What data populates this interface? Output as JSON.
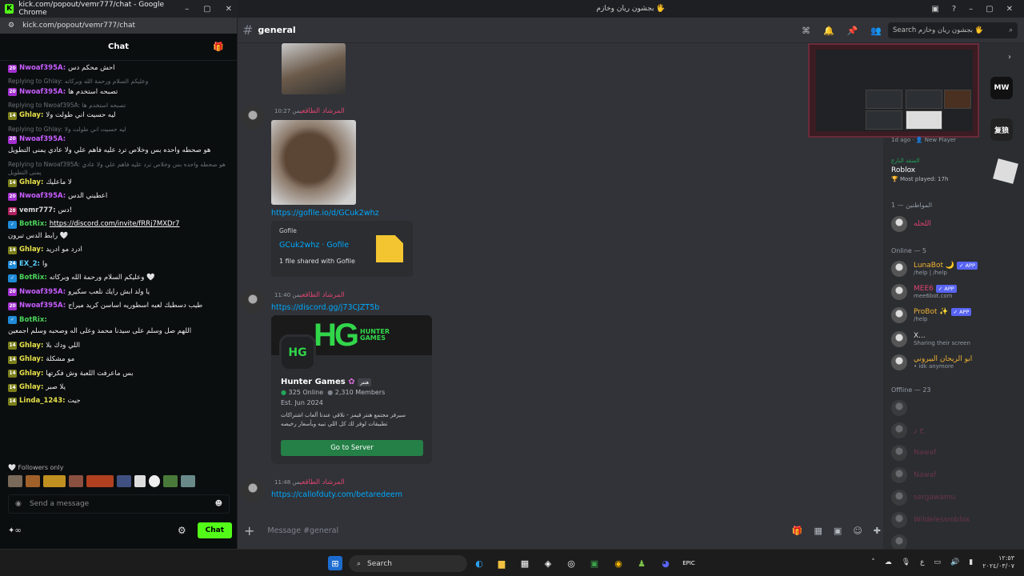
{
  "kick": {
    "window_title": "kick.com/popout/vemr777/chat - Google Chrome",
    "url": "kick.com/popout/vemr777/chat",
    "chat_title": "Chat",
    "messages": [
      {
        "badge": "20",
        "user": "Nwoaf395A:",
        "text": "احش محکم دس",
        "cls": "u-nwo",
        "bc": "b20"
      },
      {
        "reply": "Replying to Ghlay: وعليكم السلام ورحمة الله وبركاته"
      },
      {
        "badge": "20",
        "user": "Nwoaf395A:",
        "text": "تصبحه استخدم ها",
        "cls": "u-nwo",
        "bc": "b20"
      },
      {
        "reply": "Replying to Nwoaf395A: تصبحه استخدم ها"
      },
      {
        "badge": "14",
        "user": "Ghlay:",
        "text": "ليه حسيت اني طولت ولا",
        "cls": "u-gh",
        "bc": "b14"
      },
      {
        "reply": "Replying to Ghlay: ليه حسيت اني طولت ولا"
      },
      {
        "badge": "20",
        "user": "Nwoaf395A:",
        "text": "هو صحطه واحده بس وخلاص ترد عليه فاهم علي ولا عادي يمنى التطويل",
        "cls": "u-nwo",
        "bc": "b20"
      },
      {
        "reply": "Replying to Nwoaf395A: هو صحطه واحده بس وخلاص ترد عليه فاهم علي ولا عادي يمنى التطويل"
      },
      {
        "badge": "14",
        "user": "Ghlay:",
        "text": "لا ماعليك",
        "cls": "u-gh",
        "bc": "b14"
      },
      {
        "badge": "20",
        "user": "Nwoaf395A:",
        "text": "اعطيني الدس",
        "cls": "u-nwo",
        "bc": "b20"
      },
      {
        "badge": "28",
        "user": "vemr777:",
        "text": "دس!",
        "cls": "u-vem",
        "bc": "b28"
      },
      {
        "badge": "bot",
        "user": "BotRix:",
        "text": "رابط الدس تبرون 🤍",
        "link": "https://discord.com/invite/fRRj7MXDr7",
        "cls": "u-bot",
        "bc": "b24"
      },
      {
        "badge": "14",
        "user": "Ghlay:",
        "text": "ادرد مو ادريد",
        "cls": "u-gh",
        "bc": "b14"
      },
      {
        "badge": "24",
        "user": "EX_2:",
        "text": "وا",
        "cls": "u-ex",
        "bc": "b24"
      },
      {
        "badge": "bot",
        "user": "BotRix:",
        "text": "وعليكم السلام ورحمة الله وبركاته 🤍",
        "cls": "u-bot",
        "bc": "b24"
      },
      {
        "badge": "20",
        "user": "Nwoaf395A:",
        "text": "يا ولد ابش رايك نلعب سكيرو",
        "cls": "u-nwo",
        "bc": "b20"
      },
      {
        "badge": "20",
        "user": "Nwoaf395A:",
        "text": "طيب دسطبك لعبه اسطوريه اساسن كريد ميراج",
        "cls": "u-nwo",
        "bc": "b20"
      },
      {
        "badge": "bot",
        "user": "BotRix:",
        "text": "اللهم صل وسلم على سيدنا محمد وعلى اله وصحبه وسلم اجمعين",
        "cls": "u-bot",
        "bc": "b24"
      },
      {
        "badge": "14",
        "user": "Ghlay:",
        "text": "اللي ودك بلا",
        "cls": "u-gh",
        "bc": "b14"
      },
      {
        "badge": "14",
        "user": "Ghlay:",
        "text": "مو مشكلة",
        "cls": "u-gh",
        "bc": "b14"
      },
      {
        "badge": "14",
        "user": "Ghlay:",
        "text": "بس ماعرفت اللعبة وش فكرتها",
        "cls": "u-gh",
        "bc": "b14"
      },
      {
        "badge": "14",
        "user": "Ghlay:",
        "text": "يلا صبر",
        "cls": "u-gh",
        "bc": "b14"
      },
      {
        "badge": "14",
        "user": "Linda_1243:",
        "text": "جيت",
        "cls": "u-lin",
        "bc": "b14"
      }
    ],
    "followers_only": "Followers only",
    "send_placeholder": "Send a message",
    "chat_button": "Chat"
  },
  "discord": {
    "window_title": "بجشون ريان وخازم 🖐",
    "channel": "general",
    "search_placeholder": "Search بجشون ريان وخازم 🖐",
    "author": "المرشاد الطاقعي",
    "posts": [
      {
        "time": "من 10:27",
        "link": "https://gofile.io/d/GCuk2whz"
      },
      {
        "time": "من 11:40",
        "link": "https://discord.gg/j73CJZT5b"
      },
      {
        "time": "من 11:48",
        "link": "https://callofduty.com/betaredeem"
      }
    ],
    "gofile": {
      "provider": "Gofile",
      "title": "GCuk2whz · Gofile",
      "desc": "1 file shared with Gofile"
    },
    "invite": {
      "name": "Hunter Games",
      "tag": "هنتر",
      "online": "325 Online",
      "members": "2,310 Members",
      "est": "Est. Jun 2024",
      "desc": "سيرفر مجتمع هنتر قيمز - نلاقي عندنا ألعاب اشتراكات تطبيقات لوفر لك كل اللي تبيه وبأسعار رخيصه",
      "button": "Go to Server",
      "banner_text": "HG"
    },
    "message_placeholder": "Message #general",
    "stream_meta": {
      "ago": "1d ago",
      "label": "New Player"
    },
    "activity": {
      "user": "المنقذ البارع",
      "game": "Roblox",
      "played": "Most played: 17h"
    },
    "sections": {
      "online_group": "المواطنين — 1",
      "online": "Online — 5",
      "offline": "Offline — 23"
    },
    "members_online": [
      {
        "name": "اللحله",
        "sub": "",
        "color": "#e04470"
      },
      {
        "name": "LunaBot 🌙",
        "sub": "/help | /help",
        "color": "#f0b232",
        "app": "✓ APP"
      },
      {
        "name": "MEE6",
        "sub": "mee6bot.com",
        "color": "#e04470",
        "app": "✓ APP"
      },
      {
        "name": "ProBot ✨",
        "sub": "/help",
        "color": "#f0b232",
        "app": "✓ APP"
      },
      {
        "name": "X...",
        "sub": "Sharing their screen",
        "color": "#dbdee1"
      },
      {
        "name": "ابو الريحان البيروني",
        "sub": "• idk anymore",
        "color": "#f0b232"
      }
    ],
    "members_offline": [
      {
        "name": ""
      },
      {
        "name": "ح ز"
      },
      {
        "name": "Nawaf"
      },
      {
        "name": "Nawaf"
      },
      {
        "name": "sergawamu"
      },
      {
        "name": "Wildelessroblox"
      },
      {
        "name": ""
      }
    ]
  },
  "taskbar": {
    "search": "Search",
    "lang": "ع",
    "time": "١٢:٥٣",
    "date": "٢٠٢٤/٠٣/٠٧"
  }
}
